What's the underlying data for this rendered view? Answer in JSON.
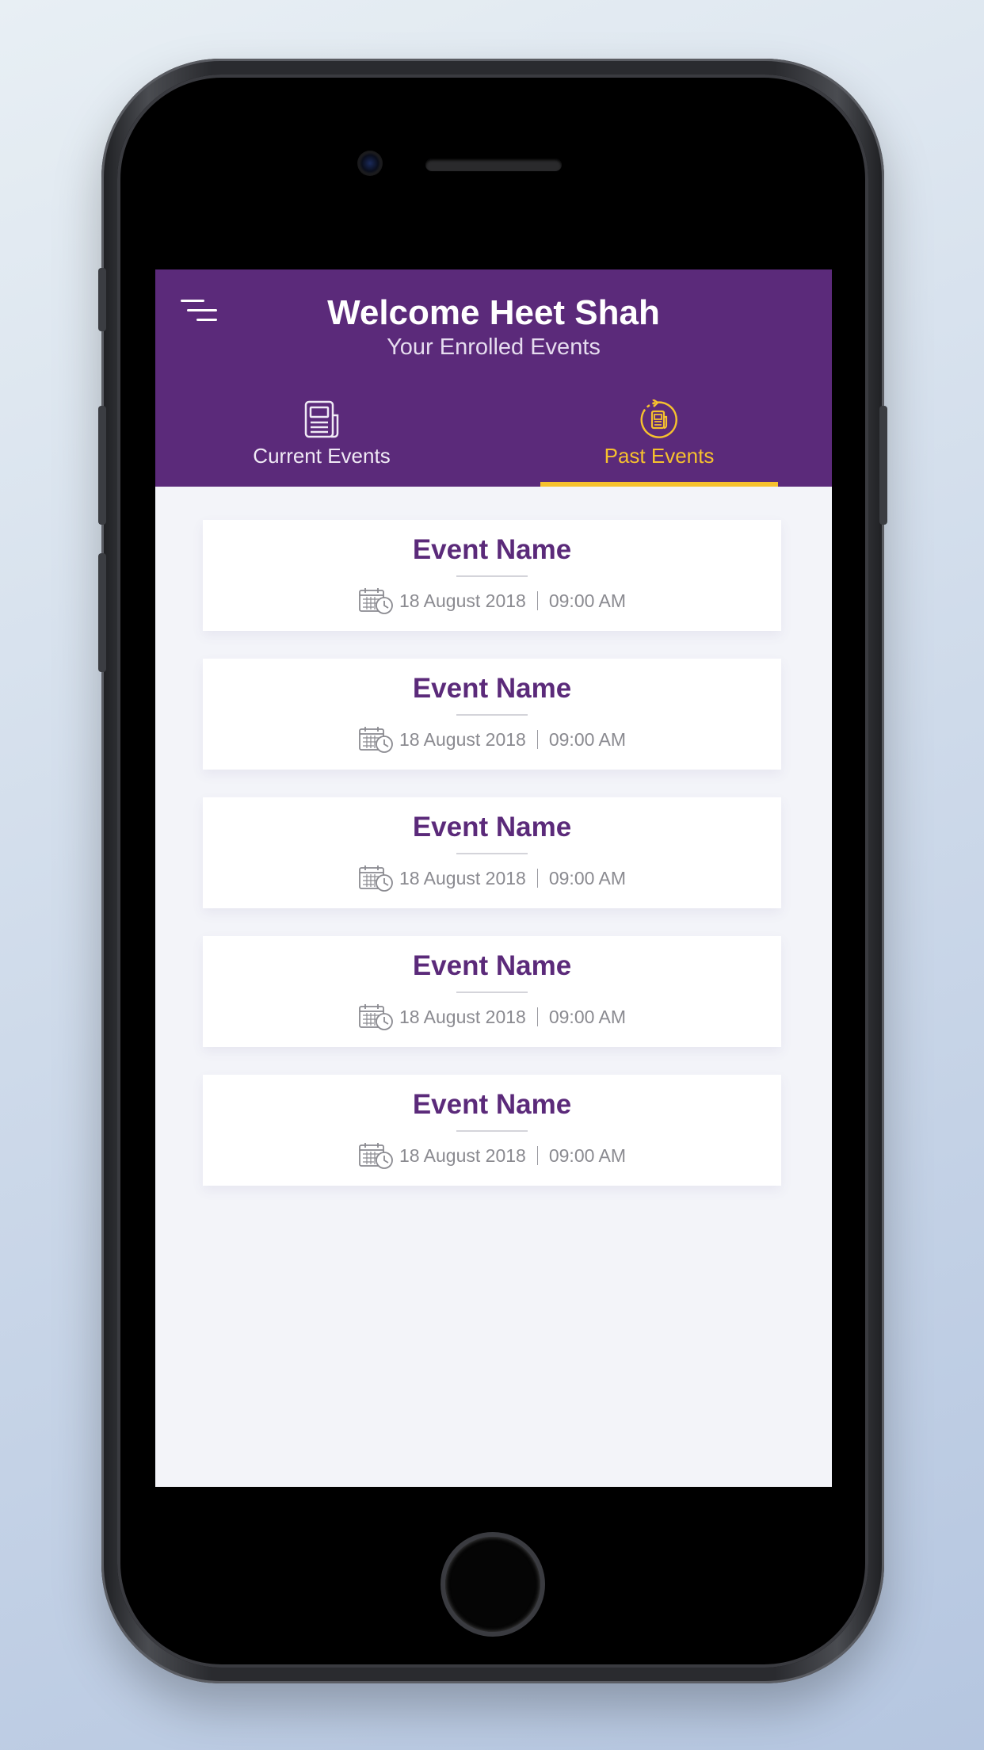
{
  "header": {
    "title": "Welcome Heet Shah",
    "subtitle": "Your Enrolled Events",
    "menu_icon": "hamburger-menu-icon"
  },
  "tabs": [
    {
      "label": "Current Events",
      "icon": "newspaper-icon",
      "active": false
    },
    {
      "label": "Past Events",
      "icon": "history-newspaper-icon",
      "active": true
    }
  ],
  "colors": {
    "header_bg": "#5b2a7a",
    "accent": "#f6c12e",
    "event_title": "#5b2a7a",
    "screen_bg": "#f3f4f9"
  },
  "events": [
    {
      "name": "Event Name",
      "date": "18 August 2018",
      "time": "09:00 AM",
      "icon": "calendar-clock-icon"
    },
    {
      "name": "Event Name",
      "date": "18 August 2018",
      "time": "09:00 AM",
      "icon": "calendar-clock-icon"
    },
    {
      "name": "Event Name",
      "date": "18 August 2018",
      "time": "09:00 AM",
      "icon": "calendar-clock-icon"
    },
    {
      "name": "Event Name",
      "date": "18 August 2018",
      "time": "09:00 AM",
      "icon": "calendar-clock-icon"
    },
    {
      "name": "Event Name",
      "date": "18 August 2018",
      "time": "09:00 AM",
      "icon": "calendar-clock-icon"
    }
  ]
}
